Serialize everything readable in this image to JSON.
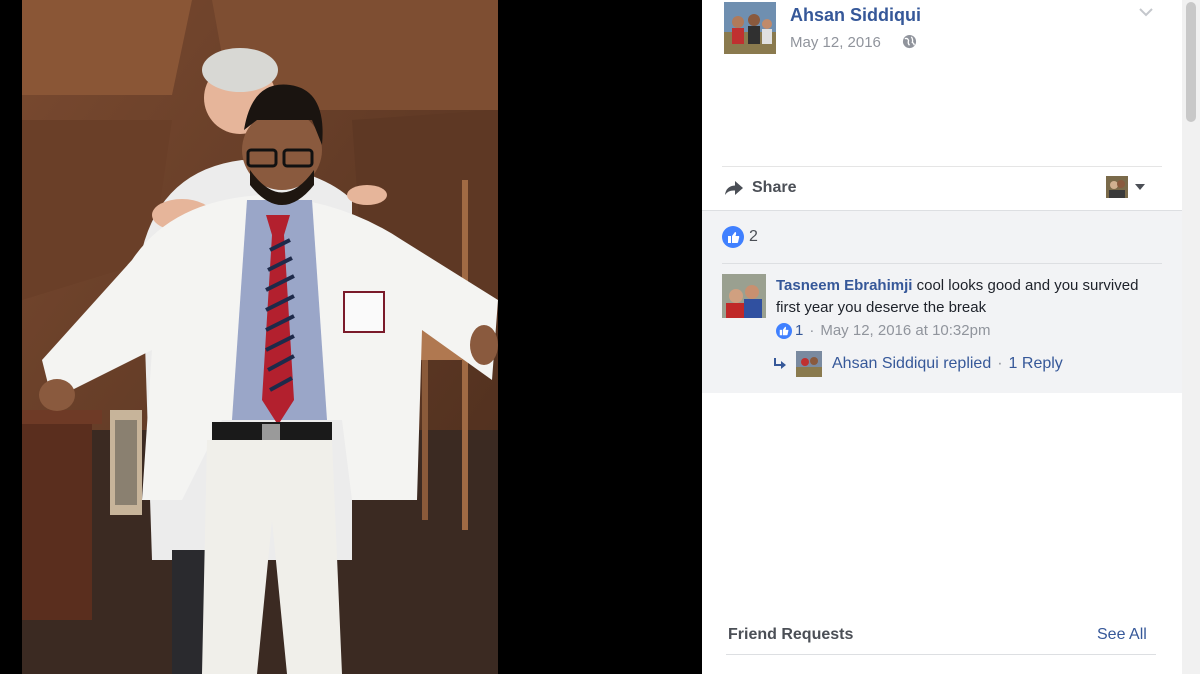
{
  "post": {
    "author_name": "Ahsan Siddiqui",
    "date": "May 12, 2016",
    "privacy_icon": "globe-icon",
    "menu_icon": "chevron-down-icon"
  },
  "actions": {
    "share_label": "Share",
    "share_icon": "share-arrow-icon"
  },
  "reactions": {
    "like_count": "2"
  },
  "comment": {
    "author": "Tasneem Ebrahimji",
    "text": "cool looks good and you survived first year you deserve the break",
    "like_count": "1",
    "separator": "·",
    "timestamp": "May 12, 2016 at 10:32pm",
    "reply_author_text": "Ahsan Siddiqui replied",
    "reply_separator": "·",
    "reply_count_text": "1 Reply"
  },
  "sidebar": {
    "friend_requests_label": "Friend Requests",
    "see_all_label": "See All"
  },
  "colors": {
    "link_blue": "#365899",
    "like_blue": "#4080ff",
    "meta_gray": "#90949c",
    "panel_gray": "#f2f3f5"
  }
}
